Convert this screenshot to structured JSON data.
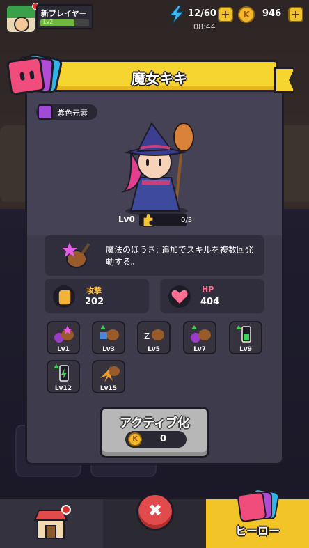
{
  "player": {
    "name": "新プレイヤー",
    "level": "Lv2",
    "xp_fraction": 0.7
  },
  "resources": {
    "energy": "12/60",
    "timer": "08:44",
    "coins": "946"
  },
  "hero": {
    "name": "魔女キキ",
    "element": "紫色元素",
    "level": "Lv0",
    "shards": "0/3",
    "skill_description": "魔法のほうき: 追加でスキルを複数回発動する。",
    "stats": [
      {
        "label": "攻撃",
        "value": "202",
        "color": "#ffc34d"
      },
      {
        "label": "HP",
        "value": "404",
        "color": "#ff6f91"
      }
    ],
    "skill_levels": [
      "Lv1",
      "Lv3",
      "Lv5",
      "Lv7",
      "Lv9",
      "Lv12",
      "Lv15"
    ]
  },
  "activate": {
    "label": "アクティブ化",
    "cost": "0"
  },
  "nav": {
    "hero_label": "ヒーロー",
    "close_symbol": "✖"
  },
  "colors": {
    "banner": "#f7d531",
    "element_purple": "#a04ad8",
    "coin": "#f4b62a",
    "close": "#e24b4b"
  }
}
